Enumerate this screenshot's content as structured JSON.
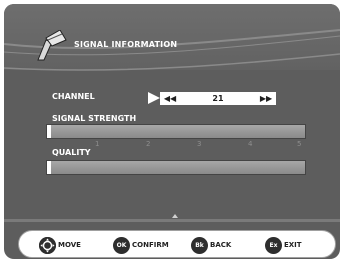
{
  "header": {
    "title": "SIGNAL INFORMATION",
    "icon": "antenna-icon"
  },
  "channel": {
    "label": "CHANNEL",
    "value": "21",
    "prev_icon": "rewind-icon",
    "next_icon": "fast-forward-icon"
  },
  "signal_strength": {
    "label": "SIGNAL STRENGTH",
    "level": 0.01,
    "scale": [
      "1",
      "2",
      "3",
      "4",
      "5"
    ]
  },
  "quality": {
    "label": "QUALITY",
    "level": 0.01
  },
  "footer": {
    "buttons": [
      {
        "icon_text": "",
        "icon": "dpad-icon",
        "label": "MOVE"
      },
      {
        "icon_text": "OK",
        "icon": "ok-icon",
        "label": "CONFIRM"
      },
      {
        "icon_text": "Bk",
        "icon": "back-icon",
        "label": "BACK"
      },
      {
        "icon_text": "Ex",
        "icon": "exit-icon",
        "label": "EXIT"
      }
    ]
  },
  "colors": {
    "panel": "#5d5d5d",
    "bar": "#9a9a9a",
    "text": "#ffffff"
  }
}
